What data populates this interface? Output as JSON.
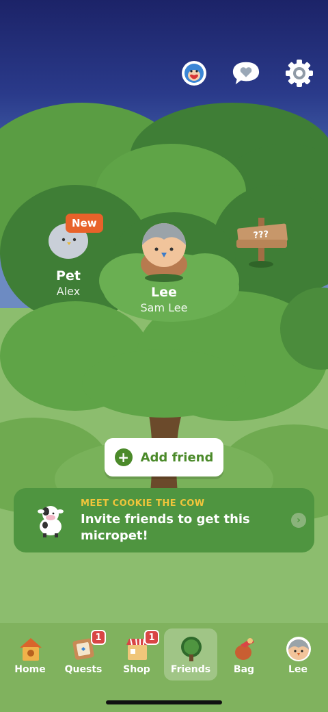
{
  "top_icons": [
    {
      "name": "mascot-heart-icon"
    },
    {
      "name": "chat-heart-icon"
    },
    {
      "name": "settings-gear-icon"
    }
  ],
  "friends": [
    {
      "label": "Pet",
      "sub": "Alex",
      "badge": "New"
    },
    {
      "label": "Lee",
      "sub": "Sam Lee"
    },
    {
      "sign": "???"
    }
  ],
  "add_friend": {
    "label": "Add friend"
  },
  "promo": {
    "kicker": "MEET COOKIE THE COW",
    "title": "Invite friends to get this micropet!"
  },
  "tabs": [
    {
      "label": "Home",
      "icon": "birdhouse-icon"
    },
    {
      "label": "Quests",
      "icon": "quests-board-icon",
      "count": "1"
    },
    {
      "label": "Shop",
      "icon": "shop-icon",
      "count": "1"
    },
    {
      "label": "Friends",
      "icon": "tree-icon",
      "active": true
    },
    {
      "label": "Bag",
      "icon": "bag-icon"
    },
    {
      "label": "Lee",
      "icon": "profile-avatar-icon"
    }
  ]
}
